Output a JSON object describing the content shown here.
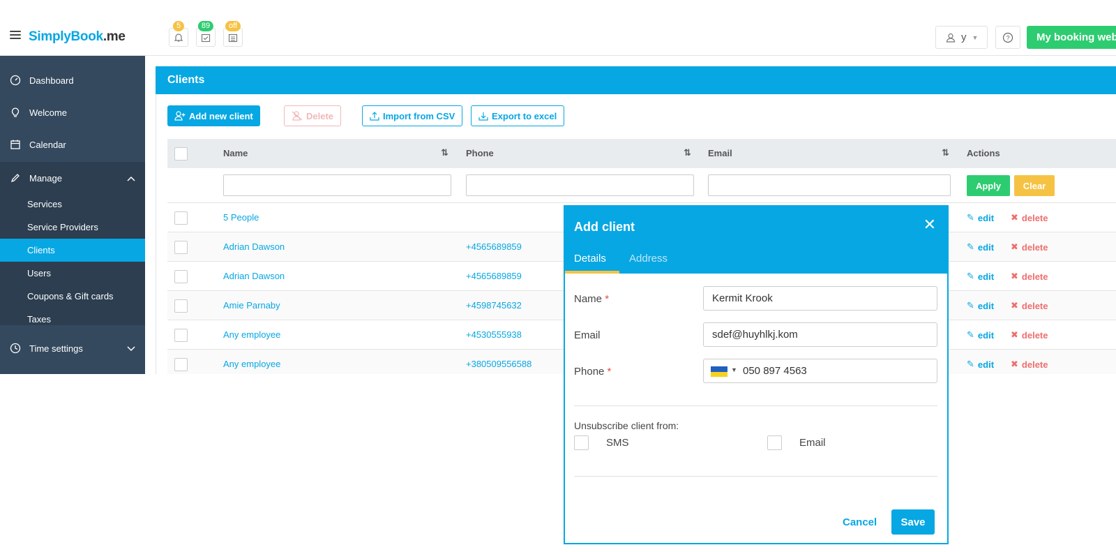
{
  "header": {
    "logo_prefix": "SimplyBook",
    "logo_suffix": ".me",
    "notifications_count": "5",
    "calendar_count": "89",
    "status_badge": "off",
    "user_name": "y",
    "booking_site_label": "My booking website",
    "colors": {
      "accent": "#07a7e3",
      "success": "#2ecc71",
      "warning": "#f6c244"
    }
  },
  "sidebar": {
    "items": [
      {
        "label": "Dashboard",
        "icon": "dashboard-icon"
      },
      {
        "label": "Welcome",
        "icon": "lightbulb-icon"
      },
      {
        "label": "Calendar",
        "icon": "calendar-icon"
      },
      {
        "label": "Manage",
        "icon": "pencil-icon"
      }
    ],
    "manage_sub": [
      "Services",
      "Service Providers",
      "Clients",
      "Users",
      "Coupons & Gift cards",
      "Taxes"
    ],
    "time_settings": "Time settings"
  },
  "panel": {
    "title": "Clients",
    "buttons": {
      "add": "Add new client",
      "delete": "Delete",
      "import": "Import from CSV",
      "export": "Export to excel"
    },
    "columns": [
      "Name",
      "Phone",
      "Email",
      "Actions"
    ],
    "apply": "Apply",
    "clear": "Clear",
    "rows": [
      {
        "name": "5 People",
        "phone": ""
      },
      {
        "name": "Adrian Dawson",
        "phone": "+4565689859"
      },
      {
        "name": "Adrian Dawson",
        "phone": "+4565689859"
      },
      {
        "name": "Amie Parnaby",
        "phone": "+4598745632"
      },
      {
        "name": "Any employee",
        "phone": "+4530555938"
      },
      {
        "name": "Any employee",
        "phone": "+380509556588"
      }
    ],
    "edit_label": "edit",
    "delete_label": "delete"
  },
  "modal": {
    "title": "Add client",
    "tabs": [
      "Details",
      "Address"
    ],
    "name_label": "Name",
    "name_value": "Kermit Krook",
    "email_label": "Email",
    "email_value": "sdef@huyhlkj.kom",
    "phone_label": "Phone",
    "phone_value": "050 897 4563",
    "required_mark": "*",
    "unsubscribe_label": "Unsubscribe client from:",
    "sms_label": "SMS",
    "email_opt_label": "Email",
    "cancel": "Cancel",
    "save": "Save"
  }
}
